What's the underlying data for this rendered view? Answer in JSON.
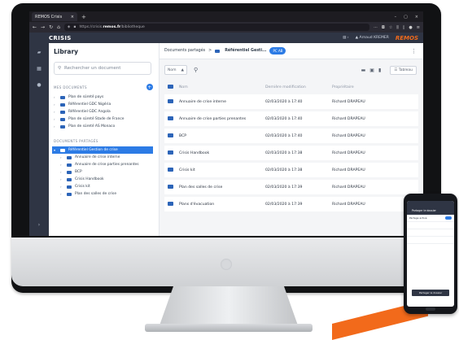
{
  "browser": {
    "tab_title": "REMOS Crisis",
    "tab_close": "×",
    "new_tab": "+",
    "window_controls": [
      "–",
      "▢",
      "×"
    ],
    "url_prefix": "https://crisis.",
    "url_host": "remos.fr",
    "url_path": "/bibliotheque"
  },
  "app": {
    "title": "CRISIS",
    "user_name": "Arnaud KREMER",
    "brand": "REMOS"
  },
  "rail": {
    "icons": [
      "layers-icon",
      "grid-icon",
      "chat-icon",
      "chevron-right-icon"
    ]
  },
  "library": {
    "title": "Library",
    "search_placeholder": "Rechercher un document",
    "my_docs_heading": "MES DOCUMENTS",
    "add_label": "+",
    "my_docs": [
      "Plan de sûreté pays",
      "Référentiel GDC Nigéria",
      "Référentiel GDC Angola",
      "Plan de sûreté Stade de France",
      "Plan de sûreté AS Monaco"
    ],
    "shared_heading": "DOCUMENTS PARTAGÉS",
    "shared_selected": "Référentiel Gestion de crise",
    "shared_children": [
      "Annuaire de crise interne",
      "Annuaire de crise parties prenantes",
      "BCP",
      "Crisis Handbook",
      "Crisis kit",
      "Plan des salles de crise"
    ]
  },
  "main": {
    "crumb_root": "Documents partagés",
    "crumb_sep": ">",
    "crumb_current": "Référentiel Gesti...",
    "shared_with": "PC AB",
    "kebab": "⋮",
    "sort_label": "Nom",
    "sort_arrow": "▲",
    "view_label": "Tableau",
    "columns": {
      "name": "Nom",
      "date": "Dernière modification",
      "owner": "Propriétaire"
    },
    "rows": [
      {
        "name": "Annuaire de crise interne",
        "date": "02/03/2020 à 17:40",
        "owner": "Richard DRAPEAU"
      },
      {
        "name": "Annuaire de crise parties prenantes",
        "date": "02/03/2020 à 17:40",
        "owner": "Richard DRAPEAU"
      },
      {
        "name": "BCP",
        "date": "02/03/2020 à 17:40",
        "owner": "Richard DRAPEAU"
      },
      {
        "name": "Crisis Handbook",
        "date": "02/03/2020 à 17:38",
        "owner": "Richard DRAPEAU"
      },
      {
        "name": "Crisis kit",
        "date": "02/03/2020 à 17:38",
        "owner": "Richard DRAPEAU"
      },
      {
        "name": "Plan des salles de crise",
        "date": "02/03/2020 à 17:39",
        "owner": "Richard DRAPEAU"
      },
      {
        "name": "Plans d'évacuation",
        "date": "02/03/2020 à 17:39",
        "owner": "Richard DRAPEAU"
      }
    ]
  },
  "phone": {
    "header": "Partager le dossier",
    "row1": "Partage activé",
    "button": "Partager le dossier"
  },
  "colors": {
    "accent": "#2c7be5",
    "header": "#2f3544",
    "brand_orange": "#f26a1b"
  }
}
